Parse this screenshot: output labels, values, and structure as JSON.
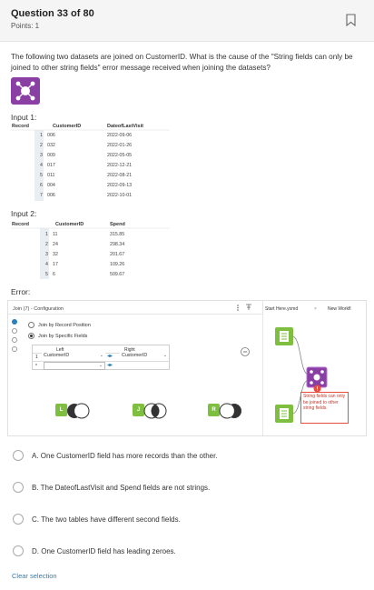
{
  "question": {
    "title": "Question 33 of 80",
    "points": "Points: 1",
    "text": "The following two datasets are joined on CustomerID. What is the cause of the \"String fields can only be joined to other string fields\" error message received when joining the datasets?"
  },
  "input1": {
    "label": "Input 1:",
    "headers": [
      "Record",
      "CustomerID",
      "DateofLastVisit"
    ],
    "rows": [
      [
        "1",
        "006",
        "2022-09-06"
      ],
      [
        "2",
        "032",
        "2022-01-26"
      ],
      [
        "3",
        "009",
        "2022-05-05"
      ],
      [
        "4",
        "017",
        "2022-12-21"
      ],
      [
        "5",
        "011",
        "2022-08-21"
      ],
      [
        "6",
        "004",
        "2022-09-13"
      ],
      [
        "7",
        "006",
        "2022-10-01"
      ]
    ]
  },
  "input2": {
    "label": "Input 2:",
    "headers": [
      "Record",
      "CustomerID",
      "Spend"
    ],
    "rows": [
      [
        "1",
        "11",
        "315.85"
      ],
      [
        "2",
        "24",
        "298.34"
      ],
      [
        "3",
        "32",
        "201.67"
      ],
      [
        "4",
        "17",
        "109.26"
      ],
      [
        "5",
        "6",
        "509.67"
      ]
    ]
  },
  "error_label": "Error:",
  "config": {
    "title": "Join (7) - Configuration",
    "option_position": "Join by Record Position",
    "option_fields": "Join by Specific Fields",
    "col_left": "Left",
    "col_right": "Right",
    "row1_no": "1",
    "row2_no": "*",
    "left_value": "CustomerID",
    "right_value": "CustomerID",
    "tool_labels": [
      "L",
      "J",
      "R"
    ]
  },
  "canvas": {
    "tab1": "Start Here.yxmd",
    "tab2": "New Workfl",
    "error_note": "String fields can only be joined to other string fields."
  },
  "answers": [
    "A. One CustomerID field has more records than the other.",
    "B. The DateofLastVisit and Spend fields are not strings.",
    "C. The two tables have different second fields.",
    "D. One CustomerID field has leading zeroes."
  ],
  "clear_label": "Clear selection",
  "colors": {
    "accent_purple": "#8a3fa5",
    "join_green": "#7fbf3f",
    "error_red": "#e74c3c",
    "link_blue": "#2a80b9"
  }
}
